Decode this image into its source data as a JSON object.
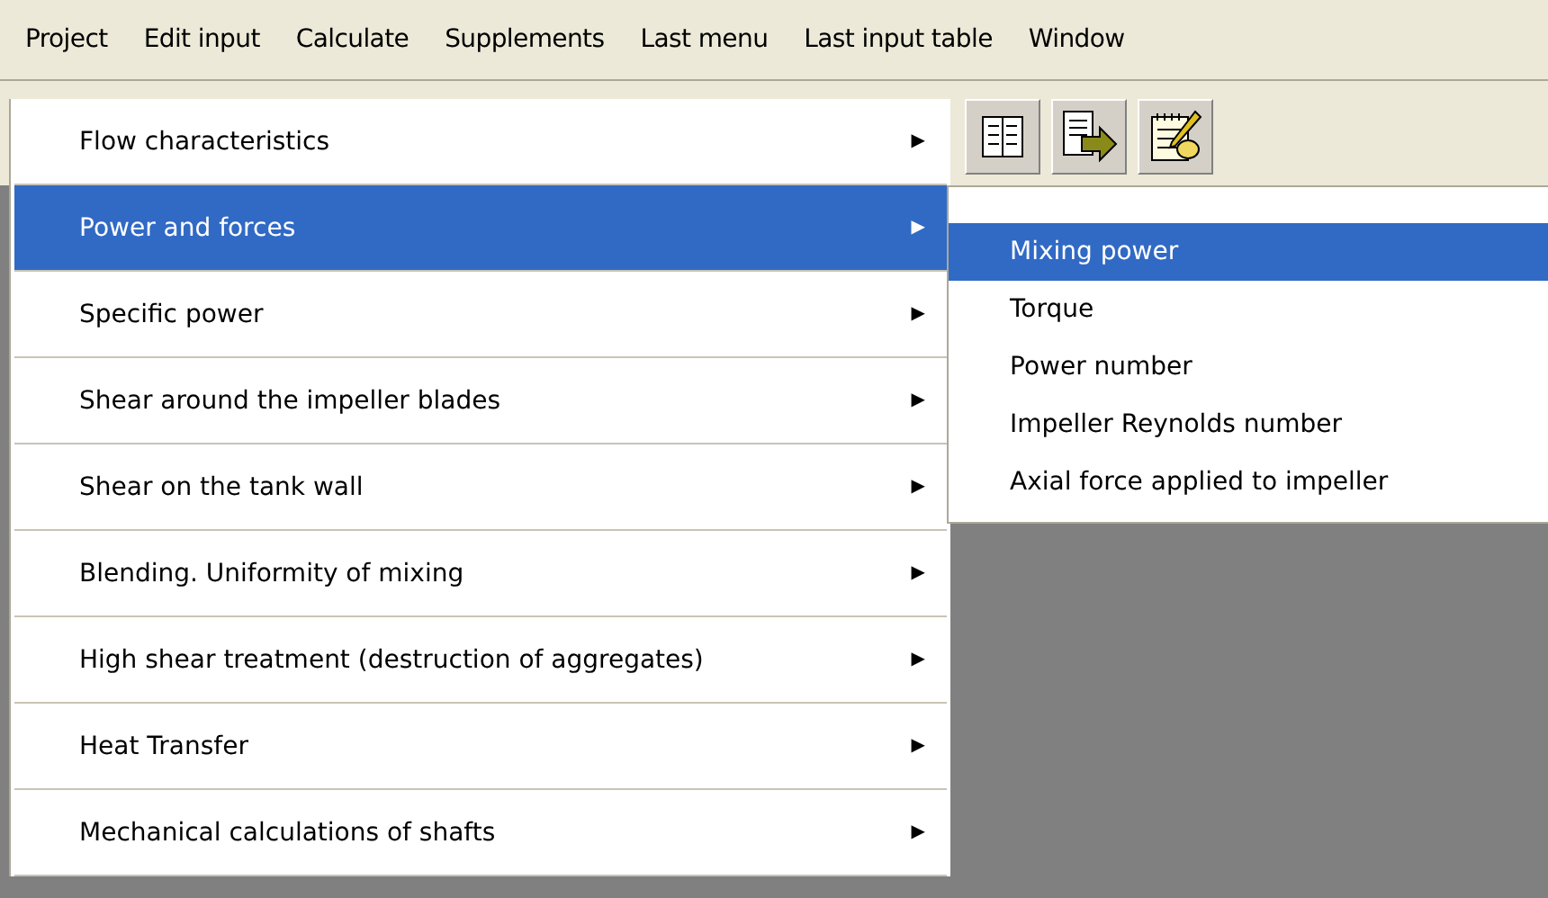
{
  "menubar": [
    {
      "label": "Project",
      "selected": false
    },
    {
      "label": "Edit input",
      "selected": false
    },
    {
      "label": "Calculate",
      "selected": false
    },
    {
      "label": "Supplements",
      "selected": false
    },
    {
      "label": "Last menu",
      "selected": false
    },
    {
      "label": "Last input table",
      "selected": false
    },
    {
      "label": "Window",
      "selected": false
    }
  ],
  "menu": {
    "items": [
      {
        "label": "Flow characteristics",
        "arrow": "▶",
        "selected": false
      },
      {
        "label": "Power and forces",
        "arrow": "▶",
        "selected": true
      },
      {
        "label": "Specific power",
        "arrow": "▶",
        "selected": false
      },
      {
        "label": "Shear around the impeller blades",
        "arrow": "▶",
        "selected": false
      },
      {
        "label": "Shear on the tank wall",
        "arrow": "▶",
        "selected": false
      },
      {
        "label": "Blending. Uniformity of mixing",
        "arrow": "▶",
        "selected": false
      },
      {
        "label": "High shear treatment (destruction of aggregates)",
        "arrow": "▶",
        "selected": false
      },
      {
        "label": "Heat Transfer",
        "arrow": "▶",
        "selected": false
      },
      {
        "label": "Mechanical calculations of shafts",
        "arrow": "▶",
        "selected": false
      }
    ]
  },
  "submenu": {
    "items": [
      {
        "label": "Mixing power",
        "selected": true
      },
      {
        "label": "Torque",
        "selected": false
      },
      {
        "label": "Power number",
        "selected": false
      },
      {
        "label": "Impeller Reynolds number",
        "selected": false
      },
      {
        "label": "Axial force applied to impeller",
        "selected": false
      }
    ]
  }
}
